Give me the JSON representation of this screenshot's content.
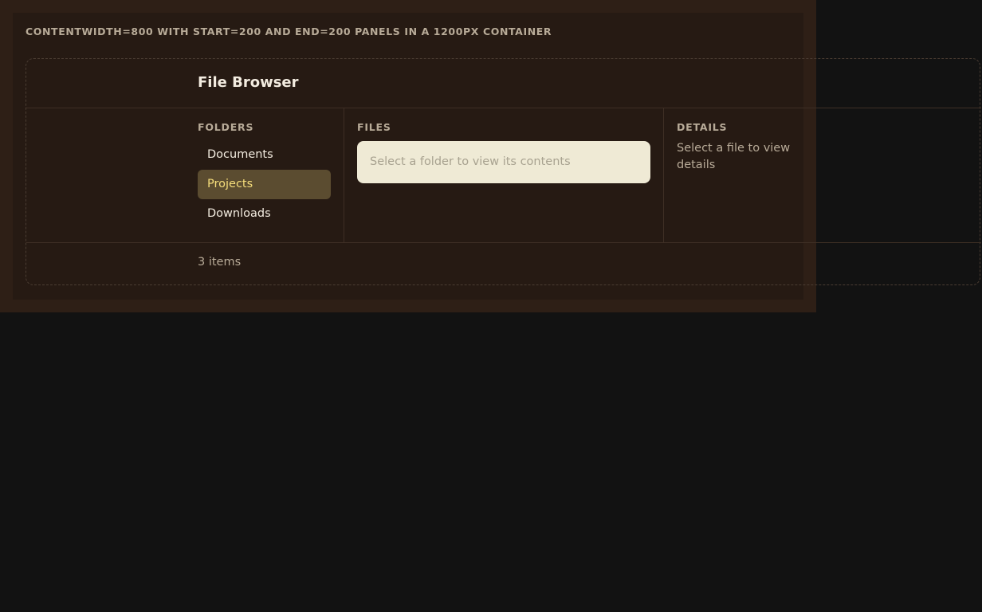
{
  "caption": "contentWidth=800 with start=200 and end=200 panels in a 1200px container",
  "browser": {
    "title": "File Browser",
    "folders": {
      "label": "Folders",
      "items": [
        {
          "label": "Documents",
          "selected": false
        },
        {
          "label": "Projects",
          "selected": true
        },
        {
          "label": "Downloads",
          "selected": false
        }
      ]
    },
    "files": {
      "label": "Files",
      "empty_message": "Select a folder to view its contents"
    },
    "details": {
      "label": "Details",
      "empty_message": "Select a file to view details"
    },
    "footer": {
      "status": "3 items"
    }
  },
  "colors": {
    "selected_background": "#5b4c30",
    "selected_text": "#f5dd7b",
    "files_box_background": "#efead5"
  }
}
